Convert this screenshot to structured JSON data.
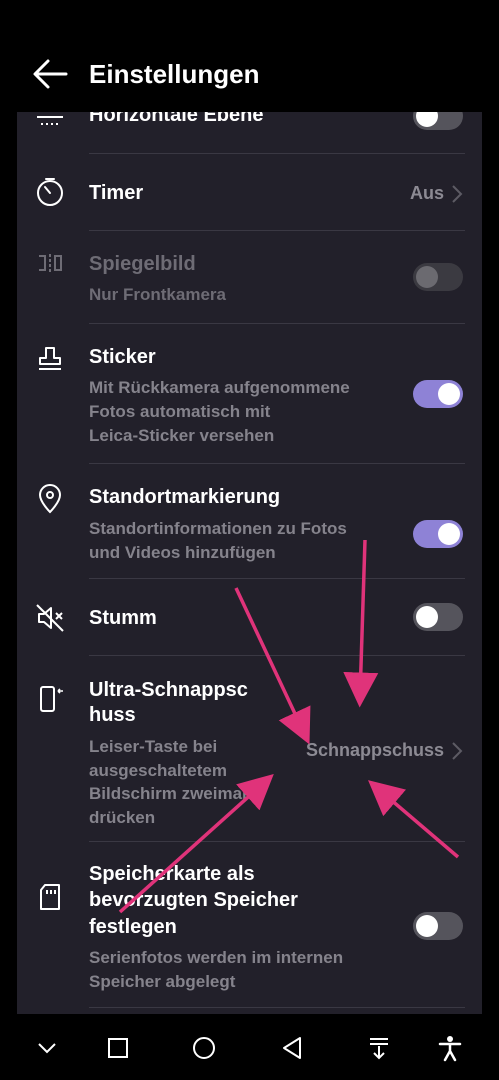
{
  "header": {
    "title": "Einstellungen"
  },
  "settings": [
    {
      "id": "horizontal",
      "label": "Horizontale Ebene",
      "icon": "level-icon",
      "toggle": "off"
    },
    {
      "id": "timer",
      "label": "Timer",
      "value": "Aus",
      "icon": "timer-icon"
    },
    {
      "id": "mirror",
      "label": "Spiegelbild",
      "sub": "Nur Frontkamera",
      "icon": "mirror-icon",
      "toggle": "off",
      "disabled": true
    },
    {
      "id": "sticker",
      "label": "Sticker",
      "sub": "Mit Rückkamera aufgenommene Fotos automatisch mit Leica-Sticker versehen",
      "icon": "stamp-icon",
      "toggle": "on"
    },
    {
      "id": "location",
      "label": "Standortmarkierung",
      "sub": "Standortinformationen zu Fotos und Videos hinzufügen",
      "icon": "location-pin-icon",
      "toggle": "on"
    },
    {
      "id": "mute",
      "label": "Stumm",
      "icon": "speaker-muted-icon",
      "toggle": "off"
    },
    {
      "id": "ultra",
      "label": "Ultra-Schnappschuss",
      "sub": "Leiser-Taste bei ausgeschaltetem Bildschirm zweimal drücken",
      "value": "Schnappschuss",
      "icon": "phone-side-key-icon"
    },
    {
      "id": "sdcard",
      "label": "Speicherkarte als bevorzugten Speicher festlegen",
      "sub": "Serienfotos werden im internen Speicher abgelegt",
      "icon": "sd-card-icon",
      "toggle": "off"
    }
  ],
  "display": {
    "horizontal_label": "Horizontale Ebene",
    "timer_label": "Timer",
    "timer_value": "Aus",
    "mirror_label": "Spiegelbild",
    "mirror_sub": "Nur Frontkamera",
    "sticker_label": "Sticker",
    "sticker_sub_1": "Mit Rückkamera aufgenommene",
    "sticker_sub_2": "Fotos automatisch mit",
    "sticker_sub_3": "Leica-Sticker versehen",
    "location_label": "Standortmarkierung",
    "location_sub_1": "Standortinformationen zu Fotos",
    "location_sub_2": "und Videos hinzufügen",
    "mute_label": "Stumm",
    "ultra_label_1": "Ultra-Schnappsc",
    "ultra_label_2": "huss",
    "ultra_sub_1": "Leiser-Taste bei",
    "ultra_sub_2": "ausgeschaltetem",
    "ultra_sub_3": "Bildschirm zweimal",
    "ultra_sub_4": "drücken",
    "ultra_value": "Schnappschuss",
    "sd_label_1": "Speicherkarte als",
    "sd_label_2": "bevorzugten Speicher",
    "sd_label_3": "festlegen",
    "sd_sub_1": "Serienfotos werden im internen",
    "sd_sub_2": "Speicher abgelegt"
  },
  "navbar": {
    "buttons": [
      "chevron-down-icon",
      "recents-square-icon",
      "home-circle-icon",
      "back-triangle-icon",
      "notification-pull-icon",
      "accessibility-icon"
    ]
  },
  "colors": {
    "accent": "#8e82d6",
    "annotation_arrow": "#e0337a",
    "panel": "#22202a"
  }
}
